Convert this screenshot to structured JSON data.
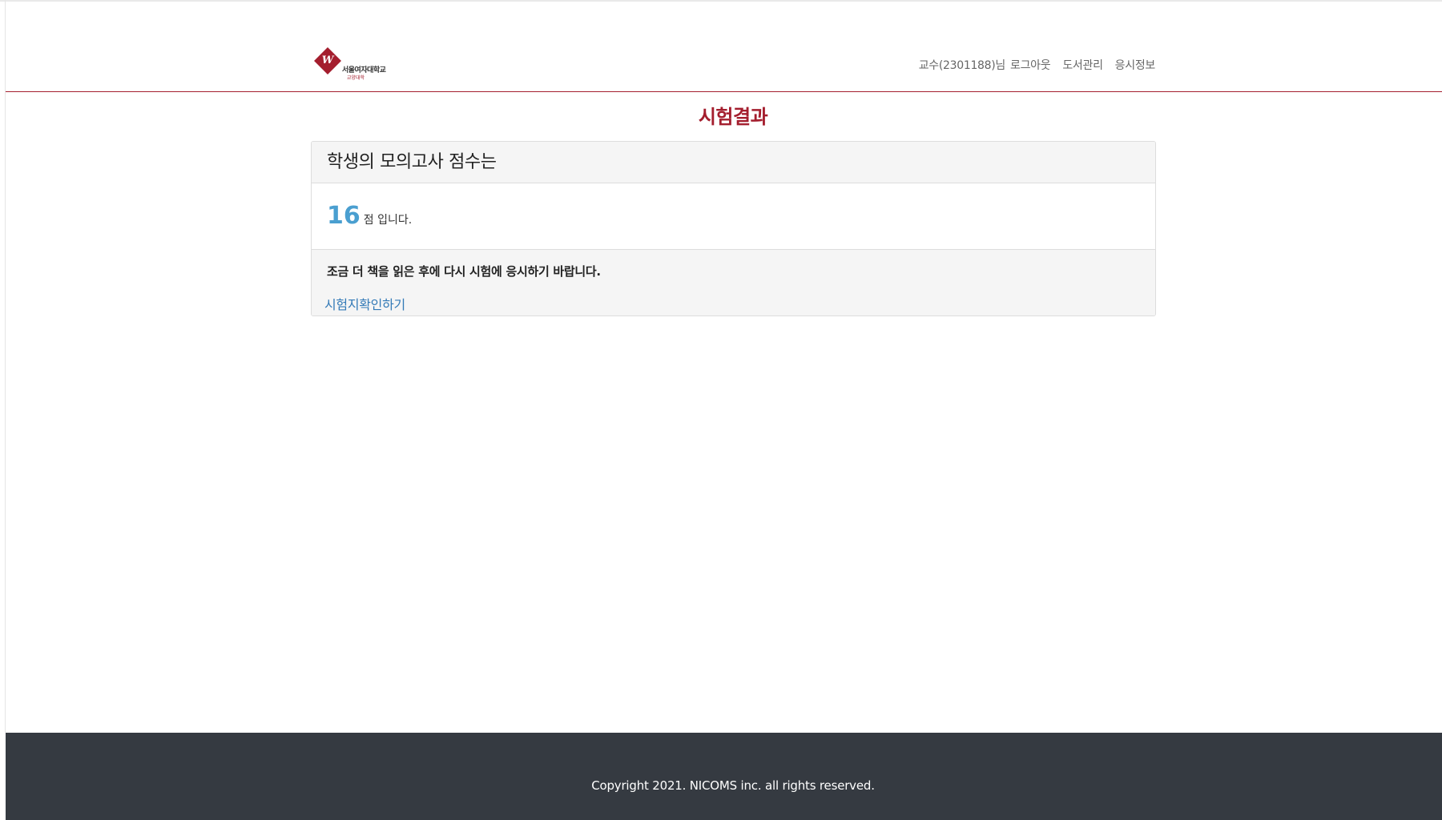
{
  "header": {
    "logo": {
      "mark": "W",
      "name": "서울여자대학교",
      "sub": "교양대학"
    },
    "nav": {
      "user_label": "교수(2301188)님",
      "logout": "로그아웃",
      "library_manage": "도서관리",
      "exam_info": "응시정보"
    }
  },
  "main": {
    "title": "시험결과",
    "panel": {
      "heading": "학생의 모의고사 점수는",
      "score": "16",
      "score_suffix": "점 입니다.",
      "message": "조금 더 책을 읽은 후에 다시 시험에 응시하기 바랍니다.",
      "confirm_link": "시험지확인하기"
    }
  },
  "footer": {
    "copyright": "Copyright 2021. NICOMS inc. all rights reserved."
  },
  "colors": {
    "brand": "#a41e2e",
    "score": "#4a9fd0",
    "link": "#337ab7",
    "footer_bg": "#353a41"
  }
}
